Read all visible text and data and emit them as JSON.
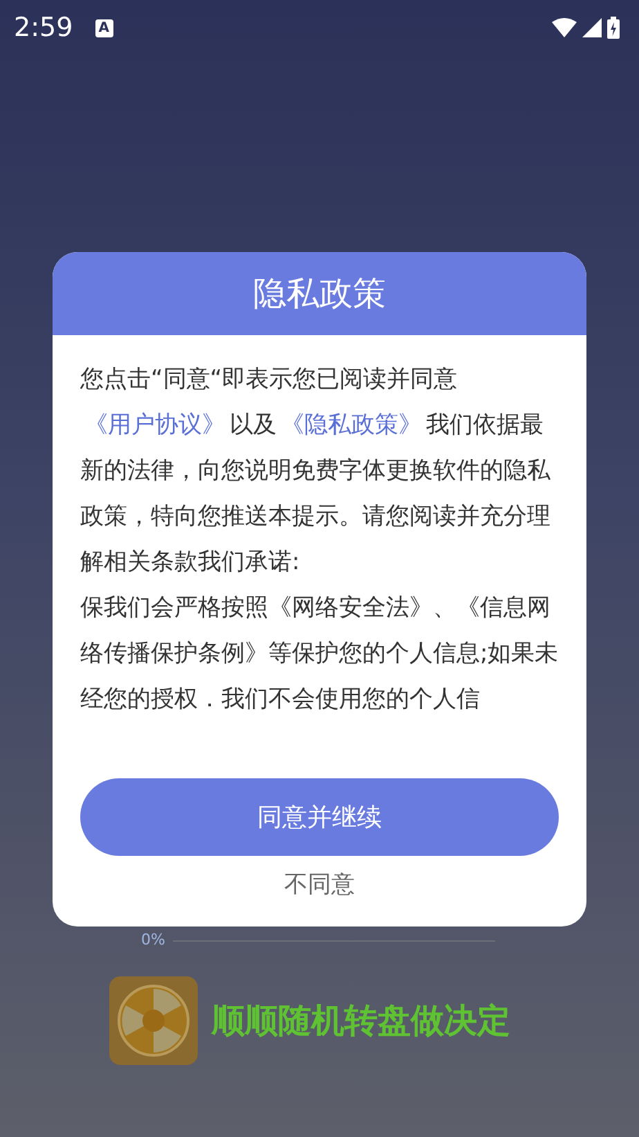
{
  "status_bar": {
    "time": "2:59",
    "notification_badge": "A"
  },
  "dialog": {
    "title": "隐私政策",
    "body": [
      {
        "kind": "text",
        "text": "您点击“同意“即表示您已阅读并同意"
      },
      {
        "kind": "link",
        "text": "《用户协议》"
      },
      {
        "kind": "text",
        "text": "以及"
      },
      {
        "kind": "link",
        "text": "《隐私政策》"
      },
      {
        "kind": "text",
        "text": "我们依据最新的法律，向您说明免费字体更换软件的隐私政策，特向您推送本提示。请您阅读并充分理解相关条款我们承诺:"
      },
      {
        "kind": "break"
      },
      {
        "kind": "text",
        "text": "保我们会严格按照《网络安全法》、《信息网络传播保护条例》等保护您的个人信息;如果未经您的授权．我们不会使用您的个人信"
      }
    ],
    "agree_button": "同意并继续",
    "disagree_button": "不同意"
  },
  "background": {
    "progress": {
      "label": "0%",
      "level": 0
    },
    "app_banner": {
      "title": "顺顺随机转盘做决定"
    }
  }
}
